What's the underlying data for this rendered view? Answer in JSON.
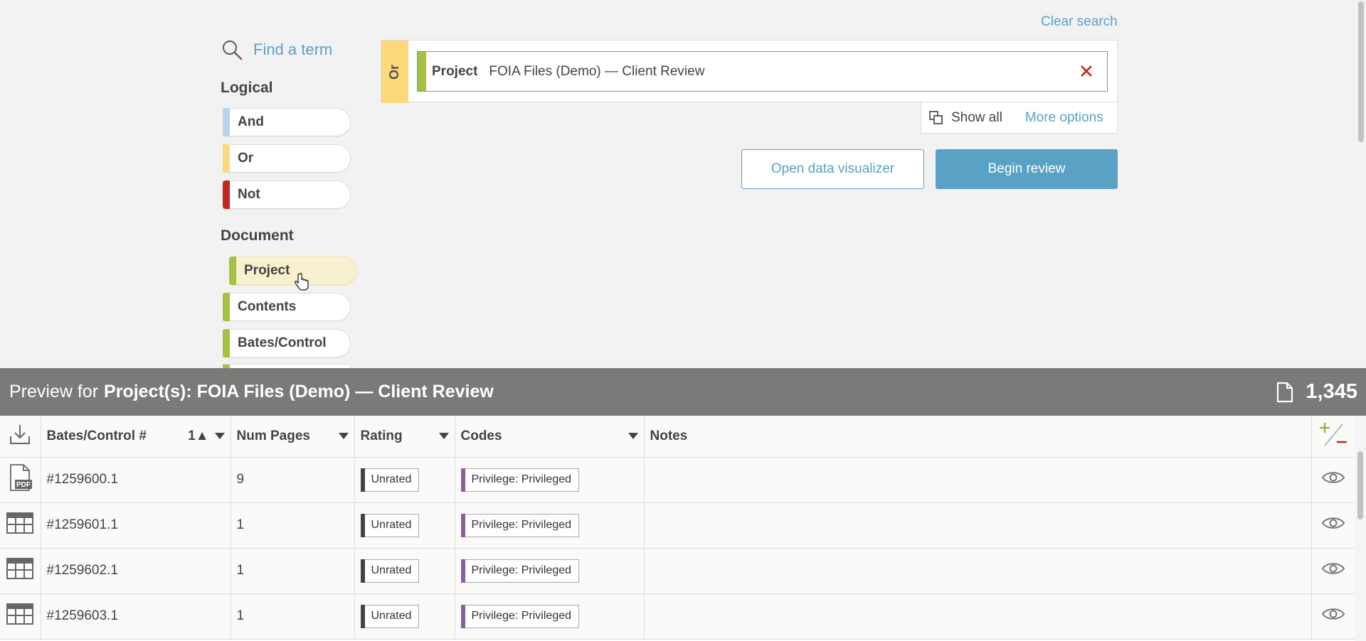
{
  "sidebar": {
    "find_term": "Find a term",
    "logical_title": "Logical",
    "logical": [
      {
        "label": "And",
        "color": "#b5d6ea"
      },
      {
        "label": "Or",
        "color": "#fcd97a"
      },
      {
        "label": "Not",
        "color": "#c0271d"
      }
    ],
    "document_title": "Document",
    "document": [
      {
        "label": "Project",
        "color": "#a4c23f"
      },
      {
        "label": "Contents",
        "color": "#a4c23f"
      },
      {
        "label": "Bates/Control",
        "color": "#a4c23f"
      }
    ]
  },
  "search": {
    "clear_label": "Clear search",
    "operator": "Or",
    "term_field": "Project",
    "term_value": "FOIA Files (Demo) — Client Review",
    "show_all": "Show all",
    "more_options": "More options",
    "visualizer_button": "Open data visualizer",
    "review_button": "Begin review"
  },
  "preview": {
    "title_prefix": "Preview for",
    "title_bold": "Project(s): FOIA Files (Demo) — Client Review",
    "count": "1,345",
    "columns": {
      "bates": "Bates/Control #",
      "sort_indicator": "1▲",
      "pages": "Num Pages",
      "rating": "Rating",
      "codes": "Codes",
      "notes": "Notes"
    },
    "rows": [
      {
        "type_icon": "pdf-icon",
        "bates": "#1259600.1",
        "pages": "9",
        "rating": "Unrated",
        "code": "Privilege: Privileged",
        "notes": ""
      },
      {
        "type_icon": "spreadsheet-icon",
        "bates": "#1259601.1",
        "pages": "1",
        "rating": "Unrated",
        "code": "Privilege: Privileged",
        "notes": ""
      },
      {
        "type_icon": "spreadsheet-icon",
        "bates": "#1259602.1",
        "pages": "1",
        "rating": "Unrated",
        "code": "Privilege: Privileged",
        "notes": ""
      },
      {
        "type_icon": "spreadsheet-icon",
        "bates": "#1259603.1",
        "pages": "1",
        "rating": "Unrated",
        "code": "Privilege: Privileged",
        "notes": ""
      }
    ]
  },
  "colors": {
    "accent": "#5aa2c5",
    "header_bg": "#7a7a78",
    "or_tab": "#fcd97a",
    "document_term": "#a4c23f",
    "code_tag": "#8b5e9b",
    "remove": "#c0271d"
  }
}
